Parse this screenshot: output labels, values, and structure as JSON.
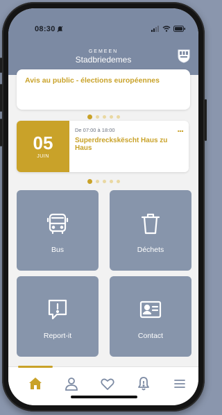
{
  "status_bar": {
    "time": "08:30",
    "icons": [
      "notification-bell-icon",
      "signal-icon",
      "wifi-icon",
      "battery-icon"
    ]
  },
  "header": {
    "small_title": "GEMEEN",
    "title": "Stadbriedemes",
    "crest_icon": "municipality-crest-icon"
  },
  "news_card": {
    "title": "Avis au public - élections européennes",
    "carousel": {
      "total": 5,
      "active_index": 0
    }
  },
  "event_card": {
    "day": "05",
    "month": "JUIN",
    "time_range": "De 07:00 à 18:00",
    "title": "Superdreckskëscht Haus zu Haus",
    "more_label": "...",
    "carousel": {
      "total": 5,
      "active_index": 0
    }
  },
  "tiles": [
    {
      "id": "bus",
      "label": "Bus",
      "icon": "bus-icon"
    },
    {
      "id": "dechets",
      "label": "Déchets",
      "icon": "trash-icon"
    },
    {
      "id": "report",
      "label": "Report-it",
      "icon": "report-icon"
    },
    {
      "id": "contact",
      "label": "Contact",
      "icon": "contact-card-icon"
    }
  ],
  "tab_bar": {
    "items": [
      "home-icon",
      "profile-icon",
      "favorites-icon",
      "notifications-icon",
      "menu-icon"
    ],
    "active": "home-icon"
  },
  "colors": {
    "accent": "#c9a229",
    "header": "#7c8aa3",
    "tile": "#8795ab",
    "background": "#f2f2f2"
  }
}
